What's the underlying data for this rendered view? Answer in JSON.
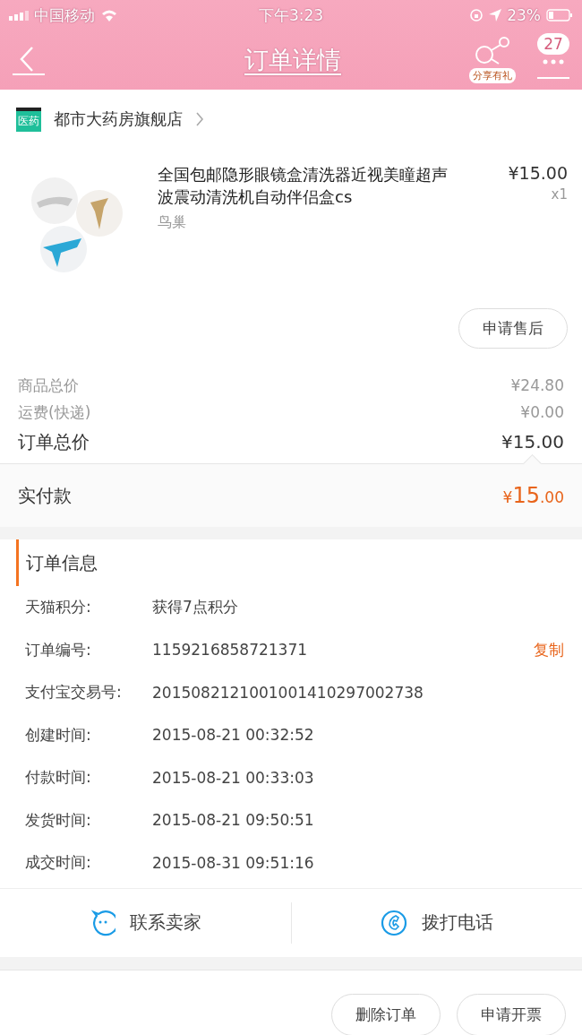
{
  "status_bar": {
    "carrier": "中国移动",
    "time": "下午3:23",
    "battery": "23%"
  },
  "nav": {
    "title": "订单详情",
    "share_label": "分享有礼",
    "badge": "27"
  },
  "shop": {
    "name": "都市大药房旗舰店",
    "logo_label": "医药"
  },
  "product": {
    "kind": "picture",
    "title": "全国包邮隐形眼镜盒清洗器近视美瞳超声波震动清洗机自动伴侣盒cs",
    "variant": "鸟巢",
    "price": "¥15.00",
    "quantity": "x1",
    "action": "申请售后"
  },
  "price_rows": [
    {
      "label": "商品总价",
      "value": "¥24.80",
      "kind": "minor"
    },
    {
      "label": "运费(快递)",
      "value": "¥0.00",
      "kind": "minor"
    },
    {
      "label": "订单总价",
      "value": "¥15.00",
      "kind": "major"
    }
  ],
  "paid": {
    "label": "实付款",
    "currency": "¥",
    "integer": "15",
    "decimal": ".00"
  },
  "order_info": {
    "title": "订单信息",
    "rows": [
      {
        "label": "天猫积分:",
        "value": "获得7点积分"
      },
      {
        "label": "订单编号:",
        "value": "1159216858721371",
        "action": "复制"
      },
      {
        "label": "支付宝交易号:",
        "value": "2015082121001001410297002738"
      },
      {
        "label": "创建时间:",
        "value": "2015-08-21 00:32:52"
      },
      {
        "label": "付款时间:",
        "value": "2015-08-21 00:33:03"
      },
      {
        "label": "发货时间:",
        "value": "2015-08-21 09:50:51"
      },
      {
        "label": "成交时间:",
        "value": "2015-08-31 09:51:16"
      }
    ]
  },
  "contact": [
    {
      "label": "联系卖家",
      "kind": "chat"
    },
    {
      "label": "拨打电话",
      "kind": "phone"
    }
  ],
  "bottom_buttons": [
    "删除订单",
    "申请开票"
  ]
}
